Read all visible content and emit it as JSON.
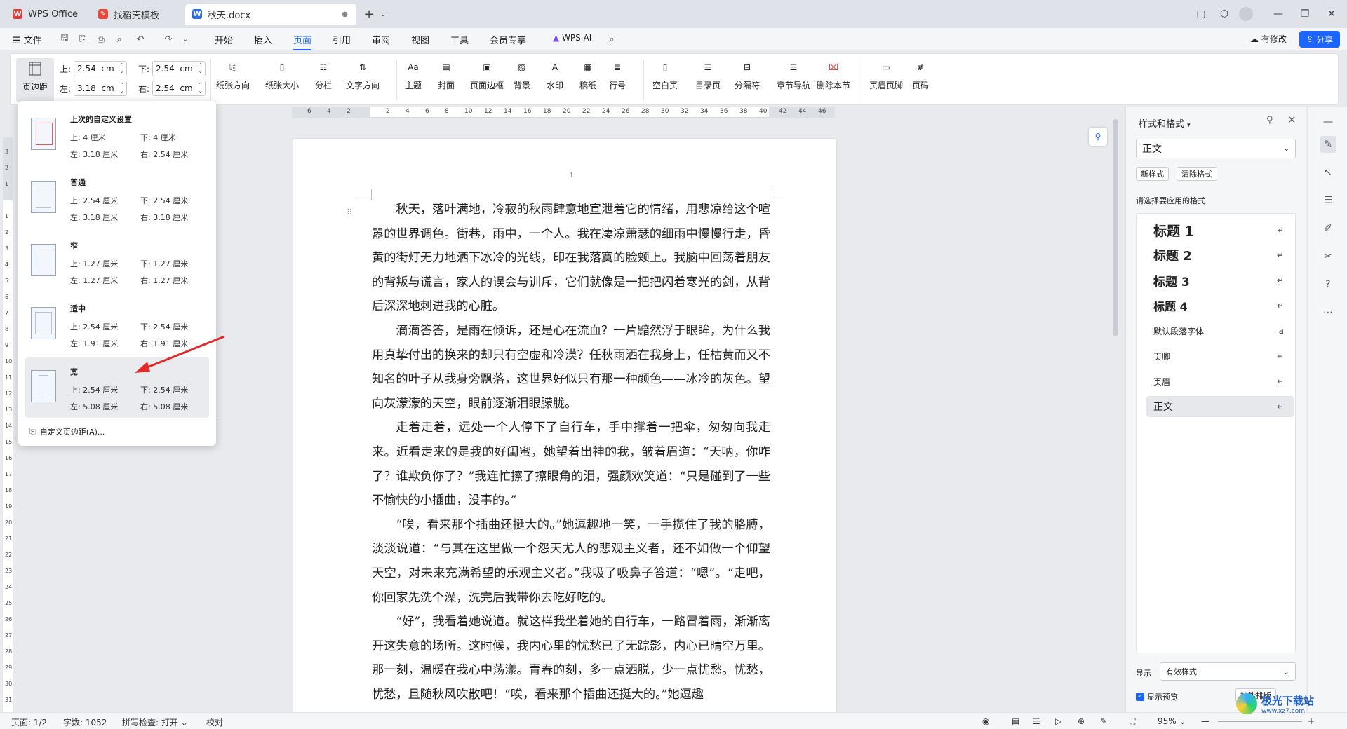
{
  "tabs": [
    {
      "label": "WPS Office",
      "icon": "wps-logo-icon"
    },
    {
      "label": "找稻壳模板",
      "icon": "docer-icon"
    },
    {
      "label": "秋天.docx",
      "icon": "word-doc-icon"
    }
  ],
  "menu": {
    "file": "文件",
    "items": [
      "开始",
      "插入",
      "页面",
      "引用",
      "审阅",
      "视图",
      "工具",
      "会员专享"
    ],
    "wps_ai": "WPS AI",
    "has_changes": "有修改",
    "share": "分享"
  },
  "ribbon": {
    "margins_btn": "页边距",
    "top_label": "上:",
    "top_value": "2.54",
    "bottom_label": "下:",
    "bottom_value": "2.54",
    "left_label": "左:",
    "left_value": "3.18",
    "right_label": "右:",
    "right_value": "2.54",
    "unit": "cm",
    "buttons": [
      "纸张方向",
      "纸张大小",
      "分栏",
      "文字方向",
      "主题",
      "封面",
      "页面边框",
      "背景",
      "水印",
      "稿纸",
      "行号",
      "空白页",
      "目录页",
      "分隔符",
      "章节导航",
      "删除本节",
      "页眉页脚",
      "页码"
    ]
  },
  "ruler_ticks": [
    "6",
    "4",
    "2",
    "",
    "2",
    "4",
    "6",
    "8",
    "10",
    "12",
    "14",
    "16",
    "18",
    "20",
    "22",
    "24",
    "26",
    "28",
    "30",
    "32",
    "34",
    "36",
    "38",
    "40",
    "42",
    "44",
    "46"
  ],
  "vruler_ticks": [
    "3",
    "2",
    "1",
    "",
    "1",
    "2",
    "3",
    "4",
    "5",
    "6",
    "7",
    "8",
    "9",
    "10",
    "11",
    "12",
    "13",
    "14",
    "15",
    "16",
    "17",
    "18",
    "19",
    "20",
    "21",
    "22",
    "23",
    "24",
    "25",
    "26",
    "27",
    "28",
    "29",
    "30",
    "31"
  ],
  "margin_menu": {
    "presets": [
      {
        "name": "上次的自定义设置",
        "top": "上: 4 厘米",
        "bottom": "下: 4 厘米",
        "left": "左: 3.18 厘米",
        "right": "右: 2.54 厘米"
      },
      {
        "name": "普通",
        "top": "上: 2.54 厘米",
        "bottom": "下: 2.54 厘米",
        "left": "左: 3.18 厘米",
        "right": "右: 3.18 厘米"
      },
      {
        "name": "窄",
        "top": "上: 1.27 厘米",
        "bottom": "下: 1.27 厘米",
        "left": "左: 1.27 厘米",
        "right": "右: 1.27 厘米"
      },
      {
        "name": "适中",
        "top": "上: 2.54 厘米",
        "bottom": "下: 2.54 厘米",
        "left": "左: 1.91 厘米",
        "right": "右: 1.91 厘米"
      },
      {
        "name": "宽",
        "top": "上: 2.54 厘米",
        "bottom": "下: 2.54 厘米",
        "left": "左: 5.08 厘米",
        "right": "右: 5.08 厘米"
      }
    ],
    "custom": "自定义页边距(A)..."
  },
  "document": {
    "page_number": "1",
    "paragraphs": [
      "秋天，落叶满地，冷寂的秋雨肆意地宣泄着它的情绪，用悲凉给这个喧嚣的世界调色。街巷，雨中，一个人。我在凄凉萧瑟的细雨中慢慢行走，昏黄的街灯无力地洒下冰冷的光线，印在我落寞的脸颊上。我脑中回荡着朋友的背叛与谎言，家人的误会与训斥，它们就像是一把把闪着寒光的剑，从背后深深地刺进我的心脏。",
      "滴滴答答，是雨在倾诉，还是心在流血？一片黯然浮于眼眸，为什么我用真挚付出的换来的却只有空虚和冷漠？任秋雨洒在我身上，任枯黄而又不知名的叶子从我身旁飘落，这世界好似只有那一种颜色——冰冷的灰色。望向灰濛濛的天空，眼前逐渐泪眼朦胧。",
      "走着走着，远处一个人停下了自行车，手中撑着一把伞，匆匆向我走来。近看走来的是我的好闺蜜，她望着出神的我，皱着眉道：“天呐，你咋了？谁欺负你了？”我连忙擦了擦眼角的泪，强颜欢笑道：“只是碰到了一些不愉快的小插曲，没事的。”",
      "“唉，看来那个插曲还挺大的。”她逗趣地一笑，一手揽住了我的胳膊，淡淡说道：“与其在这里做一个怨天尤人的悲观主义者，还不如做一个仰望天空，对未来充满希望的乐观主义者。”我吸了吸鼻子答道：“嗯”。“走吧，你回家先洗个澡，洗完后我带你去吃好吃的。",
      "“好”，我看着她说道。就这样我坐着她的自行车，一路冒着雨，渐渐离开这失意的场所。这时候，我内心里的忧愁已了无踪影，内心已晴空万里。那一刻，温暖在我心中荡漾。青春的刻，多一点洒脱，少一点忧愁。忧愁，忧愁，且随秋风吹散吧！“唉，看来那个插曲还挺大的。”她逗趣"
    ]
  },
  "styles_panel": {
    "title": "样式和格式",
    "current": "正文",
    "new_style": "新样式",
    "clear_format": "清除格式",
    "prompt": "请选择要应用的格式",
    "styles": [
      "标题  1",
      "标题  2",
      "标题  3",
      "标题 4",
      "默认段落字体",
      "页脚",
      "页眉",
      "正文"
    ],
    "show_label": "显示",
    "show_value": "有效样式",
    "preview": "显示预览",
    "smart": "智能排版"
  },
  "status": {
    "page": "页面: 1/2",
    "words": "字数: 1052",
    "spell": "拼写检查: 打开",
    "proof": "校对",
    "zoom": "95%"
  },
  "watermark": "极光下载站",
  "watermark_url": "www.xz7.com"
}
